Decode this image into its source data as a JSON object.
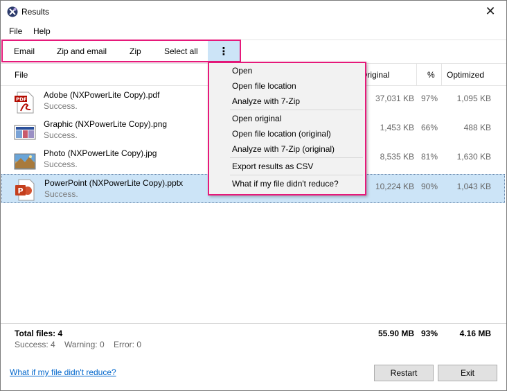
{
  "window": {
    "title": "Results",
    "close_glyph": "✕"
  },
  "menubar": {
    "items": [
      "File",
      "Help"
    ]
  },
  "toolbar": {
    "email": "Email",
    "zip_email": "Zip and email",
    "zip": "Zip",
    "select_all": "Select all",
    "more_glyph": "⋮"
  },
  "columns": {
    "file": "File",
    "original": "Original",
    "percent": "%",
    "optimized": "Optimized"
  },
  "rows": [
    {
      "name": "Adobe (NXPowerLite Copy).pdf",
      "status": "Success.",
      "original": "37,031 KB",
      "percent": "97%",
      "optimized": "1,095 KB",
      "icon": "pdf-icon"
    },
    {
      "name": "Graphic (NXPowerLite Copy).png",
      "status": "Success.",
      "original": "1,453 KB",
      "percent": "66%",
      "optimized": "488 KB",
      "icon": "image-file-icon"
    },
    {
      "name": "Photo (NXPowerLite Copy).jpg",
      "status": "Success.",
      "original": "8,535 KB",
      "percent": "81%",
      "optimized": "1,630 KB",
      "icon": "photo-file-icon"
    },
    {
      "name": "PowerPoint (NXPowerLite Copy).pptx",
      "status": "Success.",
      "original": "10,224 KB",
      "percent": "90%",
      "optimized": "1,043 KB",
      "icon": "powerpoint-icon"
    }
  ],
  "context_menu": {
    "open": "Open",
    "open_location": "Open file location",
    "analyze": "Analyze with 7-Zip",
    "open_original": "Open original",
    "open_location_original": "Open file location (original)",
    "analyze_original": "Analyze with 7-Zip (original)",
    "export_csv": "Export results as CSV",
    "what_if": "What if my file didn't reduce?"
  },
  "summary": {
    "total_files": "Total files: 4",
    "total_original": "55.90 MB",
    "total_percent": "93%",
    "total_optimized": "4.16 MB",
    "success": "Success: 4",
    "warning": "Warning: 0",
    "error": "Error: 0"
  },
  "footer": {
    "help_link": "What if my file didn't reduce?",
    "restart": "Restart",
    "exit": "Exit"
  },
  "colors": {
    "highlight": "#e6197a",
    "selection": "#cce4f7",
    "link": "#0066cc"
  }
}
